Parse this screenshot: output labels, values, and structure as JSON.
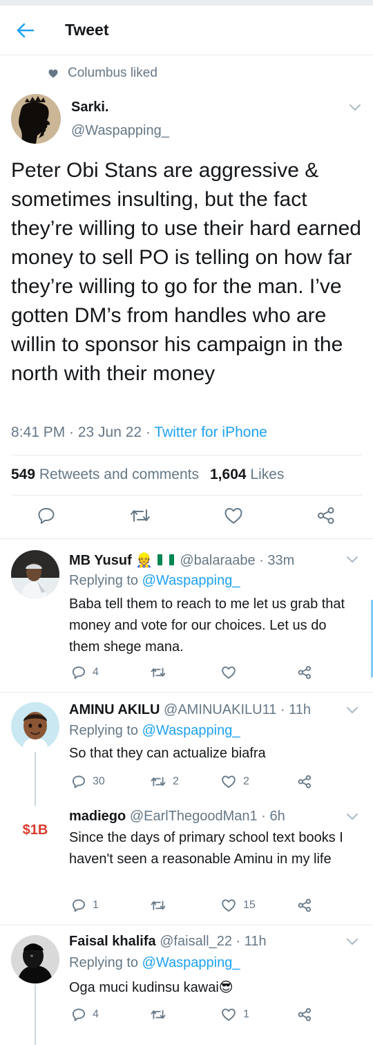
{
  "header": {
    "title": "Tweet"
  },
  "social_context": {
    "text": "Columbus liked"
  },
  "main_tweet": {
    "author_name": "Sarki.",
    "author_handle": "@Waspapping_",
    "text": "Peter Obi Stans are aggressive & sometimes insulting, but the fact they’re willing to use their hard earned money to sell PO is telling on how far they’re willing to go for the man. I’ve gotten DM’s from handles who are willin to sponsor his campaign in the north with their money",
    "time": "8:41 PM · 23 Jun 22 · ",
    "source": "Twitter for iPhone",
    "retweets_count": "549",
    "retweets_label": "Retweets and comments",
    "likes_count": "1,604",
    "likes_label": "Likes"
  },
  "replies": [
    {
      "name": "MB Yusuf",
      "emoji": "👷 ",
      "handle_time": "@balaraabe · 33m",
      "replying_to_label": "Replying to ",
      "replying_to": "@Waspapping_",
      "text": "Baba tell them to reach to me let us grab that money and vote for our choices. Let us do them shege mana.",
      "replies": "4",
      "retweets": "",
      "likes": ""
    },
    {
      "name": "AMINU AKILU",
      "handle_time": "@AMINUAKILU11 · 11h",
      "replying_to_label": "Replying to ",
      "replying_to": "@Waspapping_",
      "text": "So that they can actualize biafra",
      "replies": "30",
      "retweets": "2",
      "likes": "2"
    },
    {
      "name": "madiego",
      "handle_time": "@EarlThegoodMan1 · 6h",
      "avatar_text": "$1B",
      "text": "Since the days of primary school text books I haven't seen a reasonable Aminu in my life",
      "replies": "1",
      "retweets": "",
      "likes": "15"
    },
    {
      "name": "Faisal khalifa",
      "handle_time": "@faisall_22 · 11h",
      "replying_to_label": "Replying to ",
      "replying_to": "@Waspapping_",
      "text": "Oga muci kudinsu kawai😎",
      "replies": "4",
      "retweets": "",
      "likes": "1"
    }
  ],
  "colors": {
    "accent": "#1da1f2",
    "secondary_text": "#657786",
    "divider": "#e6ecf0",
    "flag_green": "#008751"
  }
}
